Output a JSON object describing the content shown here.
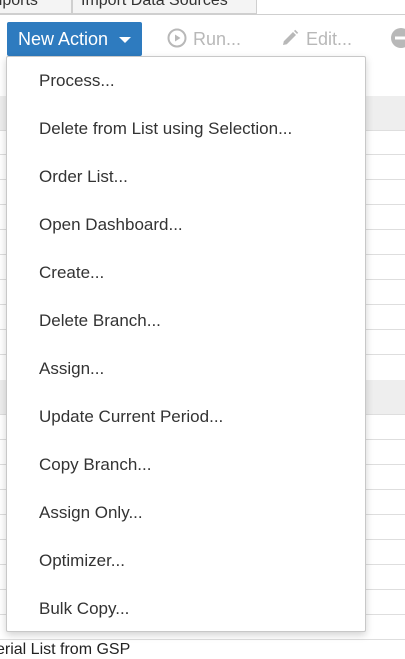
{
  "tabs": [
    "mports",
    "Import Data Sources"
  ],
  "toolbar": {
    "new_action_label": "New Action",
    "run_label": "Run...",
    "edit_label": "Edit...",
    "icons": {
      "new_action_caret": "chevron-down-icon",
      "run": "play-circle-icon",
      "edit": "pencil-icon",
      "more": "minus-circle-icon"
    },
    "accent_color": "#2e7bbf",
    "disabled_color": "#b8b8b8"
  },
  "menu": {
    "items": [
      "Process...",
      "Delete from List using Selection...",
      "Order List...",
      "Open Dashboard...",
      "Create...",
      "Delete Branch...",
      "Assign...",
      "Update Current Period...",
      "Copy Branch...",
      "Assign Only...",
      "Optimizer...",
      "Bulk Copy..."
    ]
  },
  "grid": {
    "partial_row_text": "erial List from GSP"
  }
}
